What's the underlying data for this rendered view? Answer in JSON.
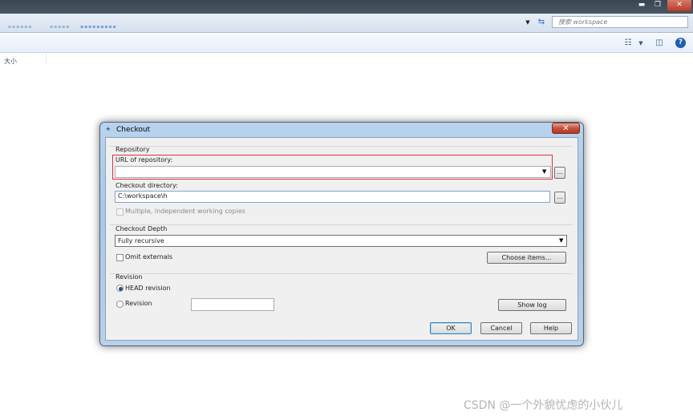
{
  "explorer": {
    "search_placeholder": "搜索 workspace",
    "column_size": "大小",
    "blurred_nav": [
      "▪▪▪▪▪▪",
      "▪▪▪▪▪",
      "▪▪▪▪▪▪▪▪▪"
    ]
  },
  "dialog": {
    "title": "Checkout",
    "repository": {
      "group_label": "Repository",
      "url_label": "URL of repository:",
      "url_value": "",
      "checkout_dir_label": "Checkout directory:",
      "checkout_dir_value": "C:\\workspace\\h",
      "multiple_copies_label": "Multiple, independent working copies",
      "browse_label": "..."
    },
    "depth": {
      "group_label": "Checkout Depth",
      "selected": "Fully recursive",
      "omit_externals_label": "Omit externals",
      "choose_items_label": "Choose items..."
    },
    "revision": {
      "group_label": "Revision",
      "head_label": "HEAD revision",
      "revision_label": "Revision",
      "revision_value": "",
      "show_log_label": "Show log",
      "selected": "HEAD revision"
    },
    "buttons": {
      "ok": "OK",
      "cancel": "Cancel",
      "help": "Help"
    }
  },
  "highlight_color": "#d9363e",
  "watermark": "CSDN @一个外貌忧虑的小伙儿"
}
